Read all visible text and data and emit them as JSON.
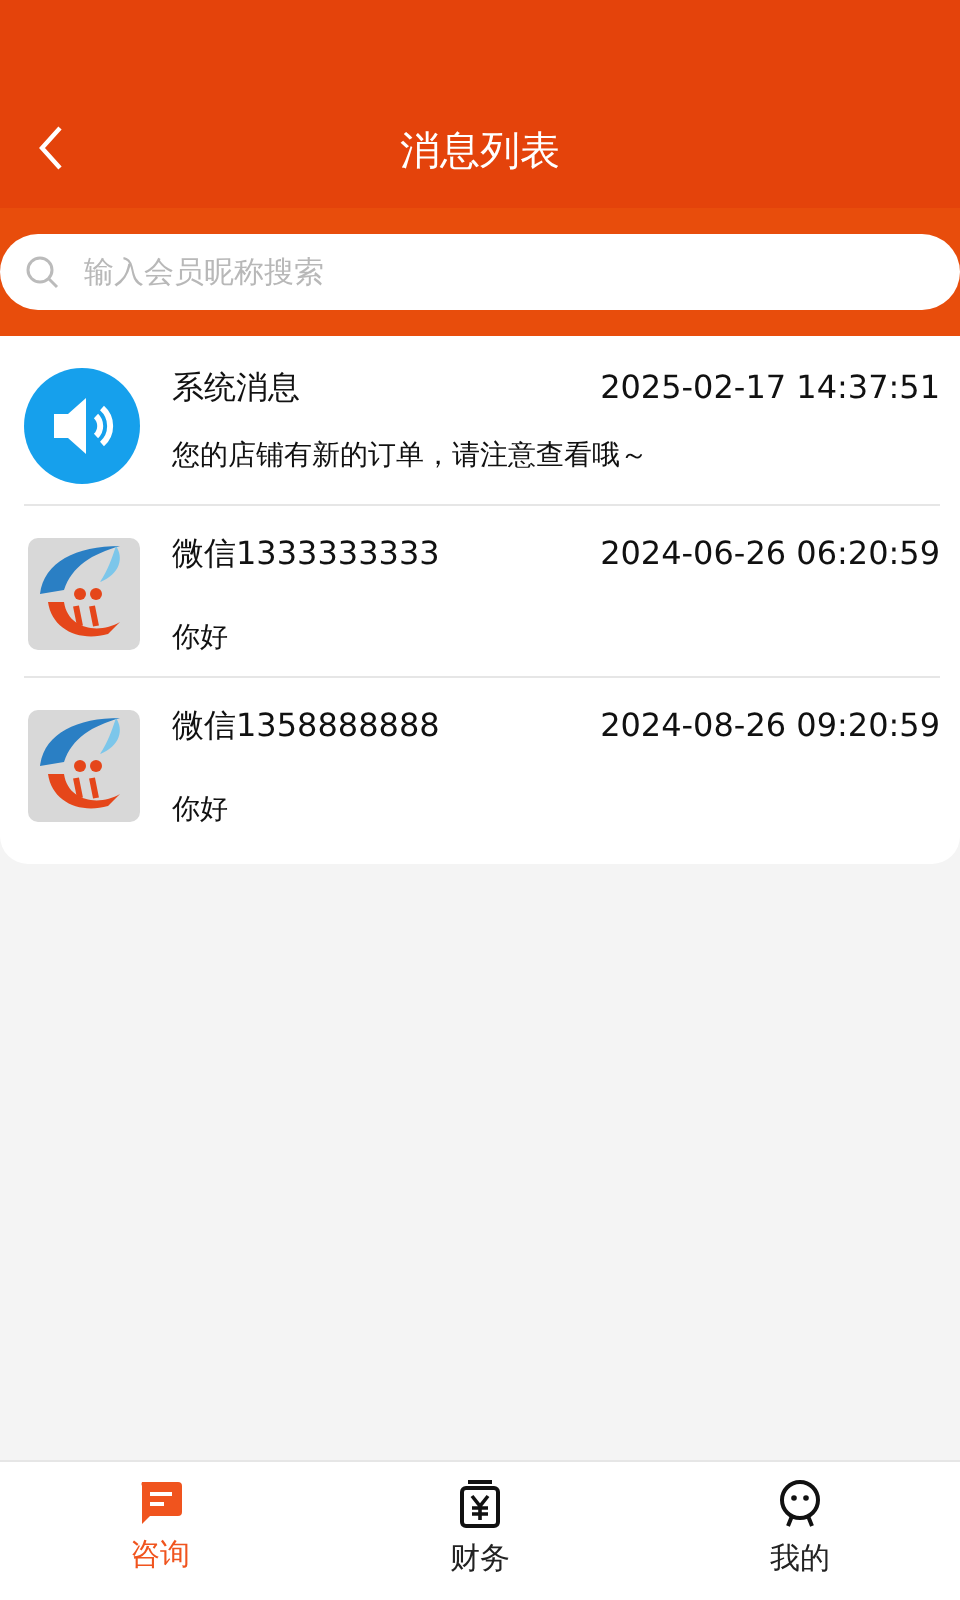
{
  "header": {
    "title": "消息列表"
  },
  "search": {
    "placeholder": "输入会员昵称搜索"
  },
  "messages": [
    {
      "kind": "system",
      "name": "系统消息",
      "time": "2025-02-17 14:37:51",
      "text": "您的店铺有新的订单，请注意查看哦～"
    },
    {
      "kind": "contact",
      "name": "微信1333333333",
      "time": "2024-06-26 06:20:59",
      "text": "你好"
    },
    {
      "kind": "contact",
      "name": "微信1358888888",
      "time": "2024-08-26 09:20:59",
      "text": "你好"
    }
  ],
  "tabs": [
    {
      "kind": "chat",
      "label": "咨询",
      "selected": true
    },
    {
      "kind": "finance",
      "label": "财务",
      "selected": false
    },
    {
      "kind": "me",
      "label": "我的",
      "selected": false
    }
  ]
}
